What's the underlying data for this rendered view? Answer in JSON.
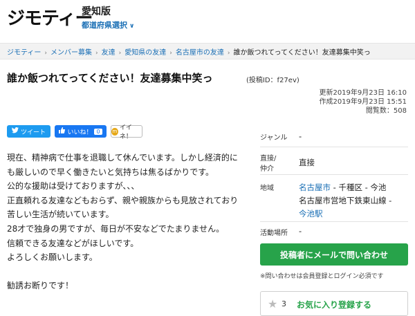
{
  "header": {
    "logo": "ジモティー",
    "edition": "愛知版",
    "pref_select": "都道府県選択"
  },
  "breadcrumb": [
    "ジモティー",
    "メンバー募集",
    "友達",
    "愛知県の友達",
    "名古屋市の友達"
  ],
  "breadcrumb_current": "誰か飯つれてってください！友達募集中笑っ",
  "post": {
    "title": "誰か飯つれてってください！友達募集中笑っ",
    "id_label": "(投稿ID：f27ev)",
    "updated": "更新2019年9月23日 16:10",
    "created": "作成2019年9月23日 15:51",
    "views": "閲覧数：508"
  },
  "share": {
    "tweet": "ツイート",
    "like": "いいね！",
    "like_count": "0",
    "iine": "イイネ！"
  },
  "body": [
    "現在、精神病で仕事を退職して休んでいます。しかし経済的に",
    "も厳しいので早く働きたいと気持ちは焦るばかりです。",
    "公的な援助は受けておりますが、、、",
    "正直頼れる友達などもおらず、親や親族からも見放されており",
    "苦しい生活が続いています。",
    "28才で独身の男ですが、毎日が不安などでたまりません。",
    "信頼できる友達などがほしいです。",
    "よろしくお願いします。",
    "",
    "勧誘お断りです！"
  ],
  "info": {
    "genre_label": "ジャンル",
    "genre_value": "-",
    "direct_label_1": "直接/",
    "direct_label_2": "仲介",
    "direct_value": "直接",
    "area_label": "地域",
    "area_city": "名古屋市",
    "area_rest": " - 千種区 - 今池",
    "area_line2": "名古屋市営地下鉄東山線 -",
    "area_station": "今池駅",
    "place_label": "活動場所",
    "place_value": "-"
  },
  "contact_button": "投稿者にメールで問い合わせ",
  "contact_note": "※問い合わせは会員登録とログイン必須です",
  "favorite": {
    "count": "3",
    "label": "お気に入り登録する"
  },
  "colors": {
    "link": "#1a6fb5",
    "green": "#27a34a",
    "twitter": "#1d9bf0",
    "facebook": "#1877f2"
  }
}
